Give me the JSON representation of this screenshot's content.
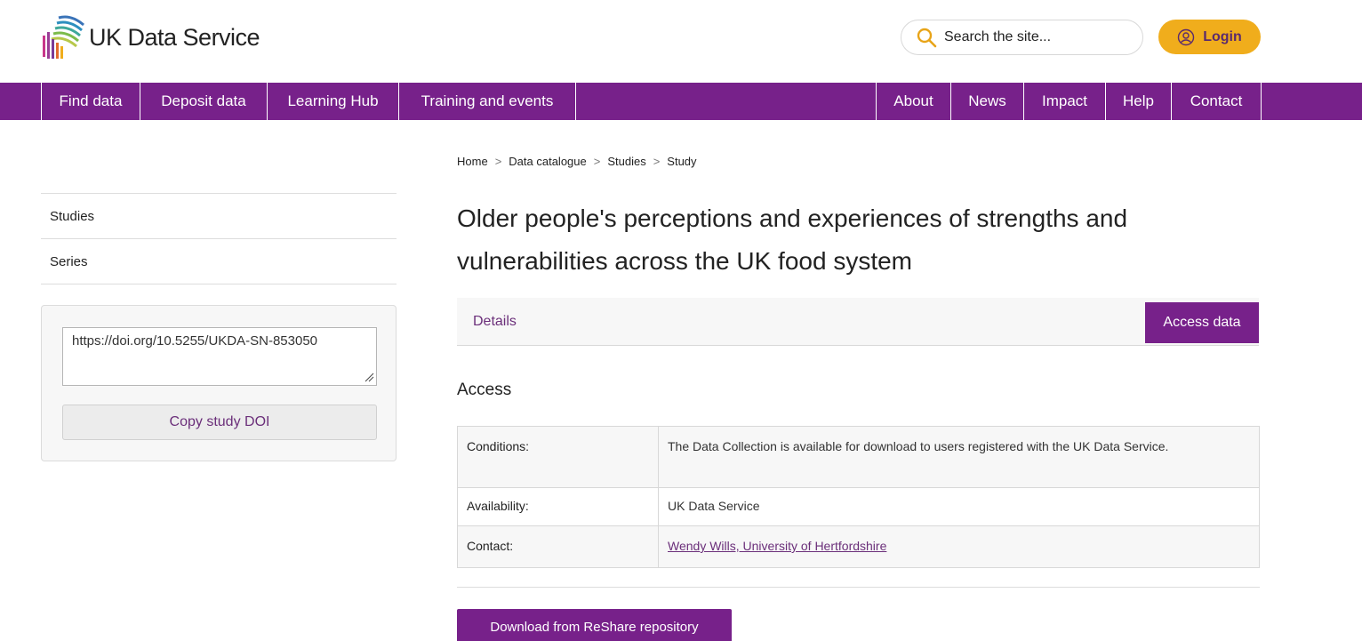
{
  "header": {
    "logo_text": "UK Data Service",
    "search_placeholder": "Search the site...",
    "login_label": "Login"
  },
  "nav": {
    "left": [
      "Find data",
      "Deposit data",
      "Learning Hub",
      "Training and events"
    ],
    "right": [
      "About",
      "News",
      "Impact",
      "Help",
      "Contact"
    ]
  },
  "breadcrumb": [
    "Home",
    "Data catalogue",
    "Studies",
    "Study"
  ],
  "sidebar": {
    "items": [
      "Studies",
      "Series"
    ],
    "doi_value": "https://doi.org/10.5255/UKDA-SN-853050",
    "copy_label": "Copy study DOI"
  },
  "main": {
    "title": "Older people's perceptions and experiences of strengths and vulnerabilities across the UK food system",
    "tabs": {
      "details": "Details",
      "access": "Access data"
    },
    "section_heading": "Access",
    "table": [
      {
        "label": "Conditions:",
        "value": "The Data Collection is available for download to users registered with the UK Data Service."
      },
      {
        "label": "Availability:",
        "value": "UK Data Service"
      },
      {
        "label": "Contact:",
        "value": "Wendy Wills, University of Hertfordshire"
      }
    ],
    "download_label": "Download from ReShare repository"
  },
  "colors": {
    "brand_purple": "#77218a",
    "login_yellow": "#f0ad1c",
    "link_purple": "#6b2f7a"
  }
}
